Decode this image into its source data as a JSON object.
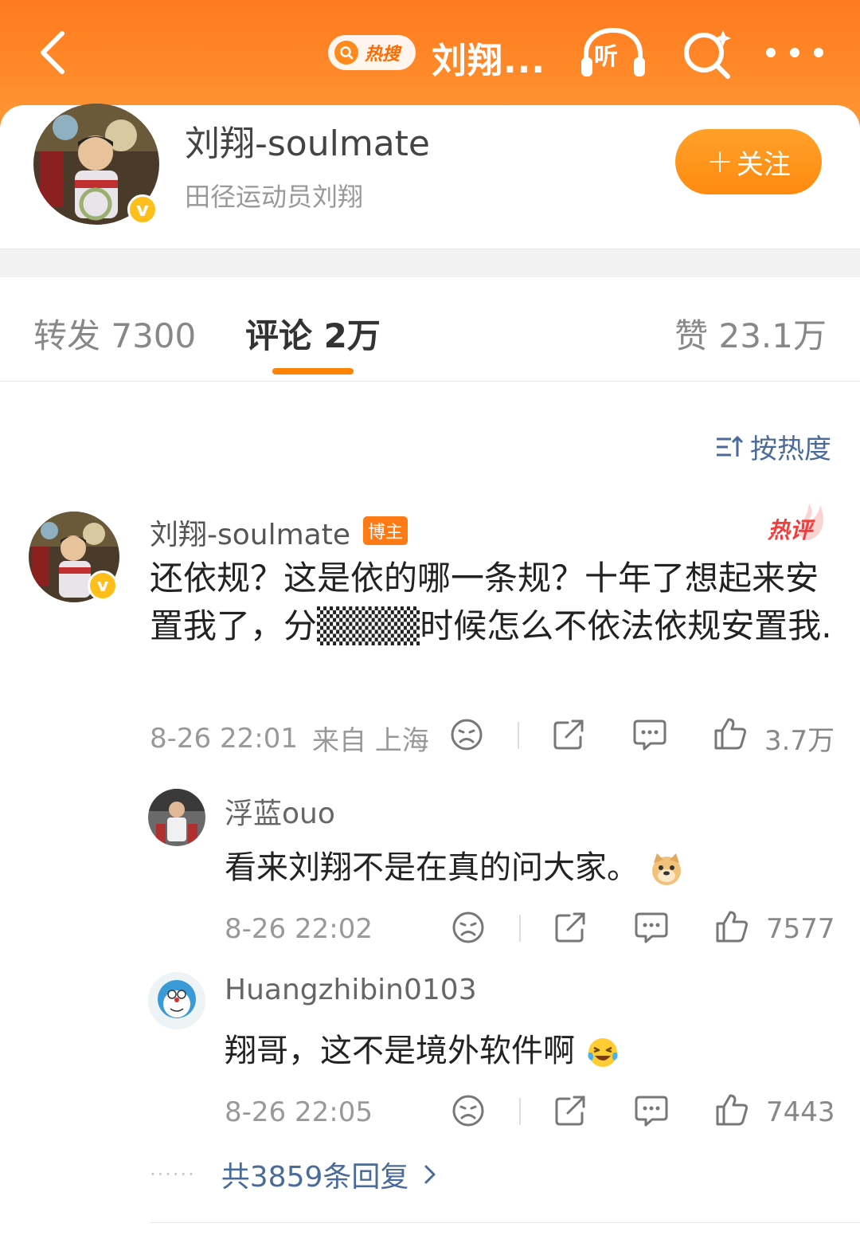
{
  "header": {
    "hot_search_label": "热搜",
    "title": "刘翔...",
    "listen_label": "听"
  },
  "profile": {
    "name": "刘翔-soulmate",
    "description": "田径运动员刘翔",
    "follow_label": "关注",
    "verified_mark": "v"
  },
  "tabs": {
    "repost": "转发 7300",
    "comments": "评论 2万",
    "likes": "赞 23.1万"
  },
  "sort_label": "按热度",
  "comment": {
    "author": "刘翔-soulmate",
    "author_badge": "博主",
    "hot_label": "热评",
    "text": "还依规？这是依的哪一条规？十年了想起来安置我了，分▒▒▒▒时候怎么不依法依规安置我.",
    "time": "8-26 22:01",
    "location": "来自 上海",
    "likes": "3.7万"
  },
  "replies": [
    {
      "author": "浮蓝ouo",
      "text": "看来刘翔不是在真的问大家。",
      "time": "8-26 22:02",
      "likes": "7577"
    },
    {
      "author": "Huangzhibin0103",
      "text": "翔哥，这不是境外软件啊",
      "time": "8-26 22:05",
      "likes": "7443"
    }
  ],
  "more_replies_label": "共3859条回复",
  "colors": {
    "header_orange": "#ff7a1f",
    "accent_orange": "#ff8200",
    "link_blue": "#4a6a9a",
    "hot_red": "#f23d3d",
    "verified_yellow": "#ffbf1a"
  }
}
